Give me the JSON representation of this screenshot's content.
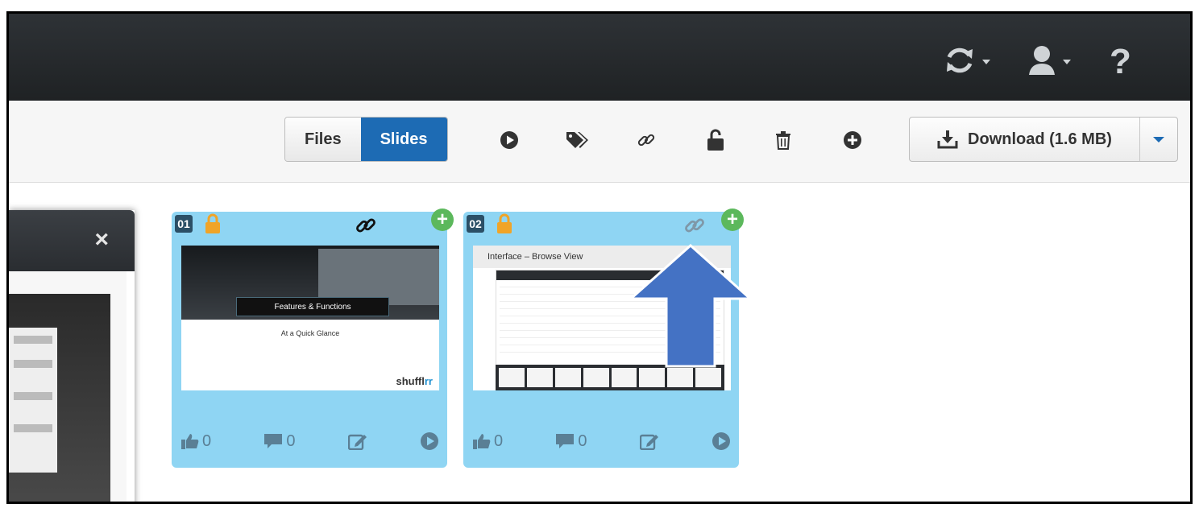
{
  "header": {
    "icons": [
      "sync-icon",
      "user-icon",
      "help-icon"
    ],
    "help_label": "?"
  },
  "toolbar": {
    "view_toggle": {
      "files_label": "Files",
      "slides_label": "Slides",
      "active": "Slides"
    },
    "tools": [
      "play-icon",
      "tags-icon",
      "link-icon",
      "unlock-icon",
      "trash-icon",
      "add-circle-icon"
    ],
    "download_label": "Download (1.6 MB)"
  },
  "preview_panel": {
    "close_label": "×"
  },
  "slides": [
    {
      "number": "01",
      "locked": true,
      "linked": true,
      "thumb": {
        "banner": "Features & Functions",
        "subtitle": "At a Quick Glance",
        "logo_prefix": "shuffl",
        "logo_suffix": "rr"
      },
      "likes": "0",
      "comments": "0"
    },
    {
      "number": "02",
      "locked": true,
      "linked": false,
      "thumb": {
        "title": "Interface – Browse View"
      },
      "likes": "0",
      "comments": "0"
    }
  ],
  "colors": {
    "navbar": "#1f2224",
    "accent": "#1d6bb4",
    "card_bg": "#8fd5f3",
    "lock": "#f0a428",
    "plus": "#5cb85c",
    "arrow": "#4472c4"
  }
}
